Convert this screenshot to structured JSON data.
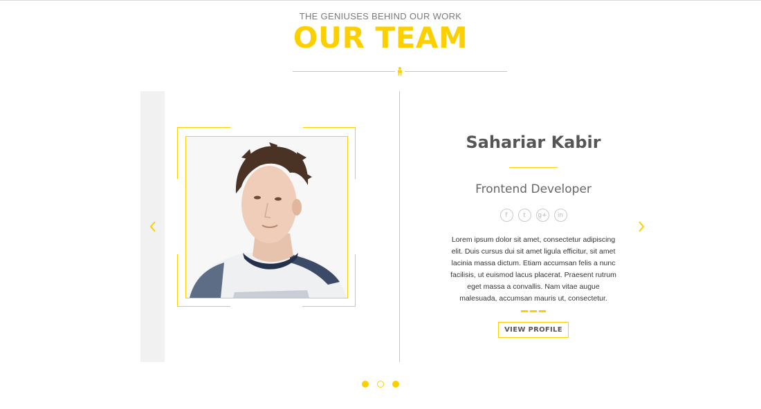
{
  "header": {
    "eyebrow": "THE GENIUSES BEHIND OUR WORK",
    "title": "OUR TEAM"
  },
  "colors": {
    "accent": "#fcd000",
    "text": "#555555",
    "muted_panel": "#f1f1f1"
  },
  "divider_icon": "figure-icon",
  "slider": {
    "prev_icon": "chevron-left-icon",
    "next_icon": "chevron-right-icon",
    "member": {
      "photo_alt": "portrait-photo",
      "name": "Sahariar Kabir",
      "role": "Frontend Developer",
      "socials": [
        {
          "icon": "facebook-icon",
          "glyph": "f"
        },
        {
          "icon": "twitter-icon",
          "glyph": "t"
        },
        {
          "icon": "google-plus-icon",
          "glyph": "g+"
        },
        {
          "icon": "linkedin-icon",
          "glyph": "in"
        }
      ],
      "bio": "Lorem ipsum dolor sit amet, consectetur adipiscing elit. Duis cursus dui sit amet ligula efficitur, sit amet lacinia massa dictum. Etiam accumsan felis a nunc facilisis, ut euismod lacus placerat. Praesent rutrum eget massa a convallis. Nam vitae augue malesuada, accumsan mauris ut, consectetur.",
      "button_label": "VIEW PROFILE"
    }
  },
  "pagination": {
    "count": 3,
    "active_index": 1
  }
}
